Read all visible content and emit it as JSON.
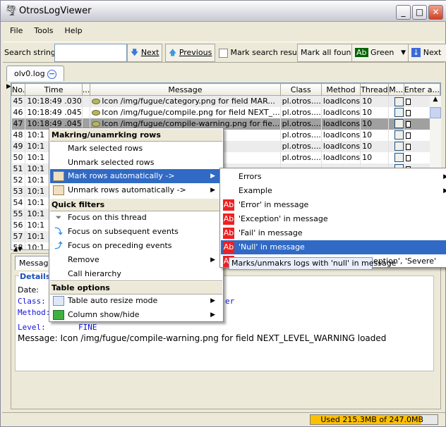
{
  "window": {
    "title": "OtrosLogViewer",
    "icon": "tornado-icon"
  },
  "menubar": [
    "File",
    "Tools",
    "Help"
  ],
  "toolbar": {
    "search_label": "Search string:",
    "search_value": "",
    "next_label": "Next",
    "previous_label": "Previous",
    "mark_search_result_label": "Mark search result",
    "mark_search_checked": false,
    "mark_all_found_label": "Mark all found",
    "color_value": "Green",
    "color_hex": "#006400",
    "color_badge": "Ab",
    "next2_label": "Next"
  },
  "tabs": [
    {
      "label": "olv0.log",
      "close_icon": "remove-icon"
    }
  ],
  "table": {
    "columns": [
      "No.",
      "Time",
      "...",
      "Message",
      "Class",
      "Method",
      "Thread",
      "M...",
      "Enter a..."
    ],
    "rows": [
      {
        "no": "45",
        "time": "10:18:49 .030",
        "message": "Icon /img/fugue/category.png for field MAR...",
        "class": "pl.otros....",
        "method": "loadIcons",
        "thread": "10"
      },
      {
        "no": "46",
        "time": "10:18:49 .045",
        "message": "Icon /img/fugue/compile.png for field NEXT_...",
        "class": "pl.otros....",
        "method": "loadIcons",
        "thread": "10"
      },
      {
        "no": "47",
        "time": "10:18:49 .045",
        "message": "Icon /img/fugue/compile-warning.png for fie...",
        "class": "pl.otros....",
        "method": "loadIcons",
        "thread": "10",
        "selected": true
      },
      {
        "no": "48",
        "time": "10:1",
        "message": "r field ...",
        "class": "pl.otros....",
        "method": "loadIcons",
        "thread": "10"
      },
      {
        "no": "49",
        "time": "10:1",
        "message": "field PR...",
        "class": "pl.otros....",
        "method": "loadIcons",
        "thread": "10"
      },
      {
        "no": "50",
        "time": "10:1",
        "message": "png fo...",
        "class": "pl.otros....",
        "method": "loadIcons",
        "thread": "10"
      },
      {
        "no": "51",
        "time": "10:1",
        "message": "",
        "class": "",
        "method": "",
        "thread": ""
      },
      {
        "no": "52",
        "time": "10:1",
        "message": "",
        "class": "",
        "method": "",
        "thread": ""
      },
      {
        "no": "53",
        "time": "10:1",
        "message": "",
        "class": "",
        "method": "",
        "thread": ""
      },
      {
        "no": "54",
        "time": "10:1",
        "message": "",
        "class": "",
        "method": "",
        "thread": ""
      },
      {
        "no": "55",
        "time": "10:1",
        "message": "",
        "class": "",
        "method": "",
        "thread": ""
      },
      {
        "no": "56",
        "time": "10:1",
        "message": "",
        "class": "",
        "method": "",
        "thread": ""
      },
      {
        "no": "57",
        "time": "10:1",
        "message": "",
        "class": "",
        "method": "",
        "thread": ""
      },
      {
        "no": "58",
        "time": "10:1",
        "message": "",
        "class": "",
        "method": "",
        "thread": ""
      }
    ]
  },
  "lower": {
    "tab": "Message",
    "details_title": "Details",
    "date_label": "Date:",
    "class_label": "Class:",
    "class_value": "er",
    "method_label": "Method:",
    "level_label": "Level:",
    "level_value": "FINE",
    "message_label": "Message:",
    "message_value": "Icon /img/fugue/compile-warning.png for field NEXT_LEVEL_WARNING loaded"
  },
  "context_menu": {
    "section1": "Makring/unamrking rows",
    "mark_selected": "Mark selected rows",
    "unmark_selected": "Unmark selected rows",
    "mark_auto": "Mark rows automatically ->",
    "unmark_auto": "Unmark rows automatically ->",
    "section2": "Quick filters",
    "focus_thread": "Focus on this thread",
    "focus_subsequent": "Focus on subsequent events",
    "focus_preceding": "Focus on preceding events",
    "remove": "Remove",
    "call_hierarchy": "Call hierarchy",
    "section3": "Table options",
    "auto_resize": "Table auto resize mode",
    "column_show_hide": "Column show/hide"
  },
  "submenu": {
    "items": [
      "Errors",
      "Example",
      "'Error' in message",
      "'Exception' in message",
      "'Fail' in message",
      "'Null' in message",
      "ception', 'Severe'"
    ],
    "badge": "Ab",
    "badge_color": "#ef2020",
    "highlighted": "'Null' in message"
  },
  "tooltip": "Marks/unmakrs logs with 'null' in message",
  "status": {
    "memory_text": "Used 215.3MB of 247.0MB",
    "used_mb": 215.3,
    "total_mb": 247.0,
    "bar_color": "#ffc000"
  }
}
